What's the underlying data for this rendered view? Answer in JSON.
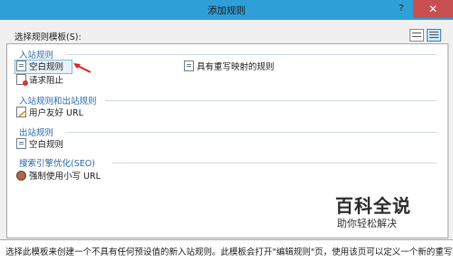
{
  "window": {
    "title": "添加规则",
    "help": "?",
    "close": "✕"
  },
  "panel": {
    "label": "选择规则模板(S):"
  },
  "groups": [
    {
      "header": "入站规则",
      "items": [
        "空白规则",
        "请求阻止"
      ]
    },
    {
      "header": "入站规则和出站规则",
      "items": [
        "用户友好 URL"
      ]
    },
    {
      "header": "出站规则",
      "items": [
        "空白规则"
      ]
    },
    {
      "header": "搜索引擎优化(SEO)",
      "items": [
        "强制使用小写 URL"
      ]
    }
  ],
  "right_item": "具有重写映射的规则",
  "selected_item": "空白规则",
  "watermark": {
    "title": "百科全说",
    "subtitle": "助你轻松解决"
  },
  "description": "选择此模板来创建一个不具有任何预设值的新入站规则。此模板会打开\"编辑规则\"页，使用该页可以定义一个新的重写规"
}
